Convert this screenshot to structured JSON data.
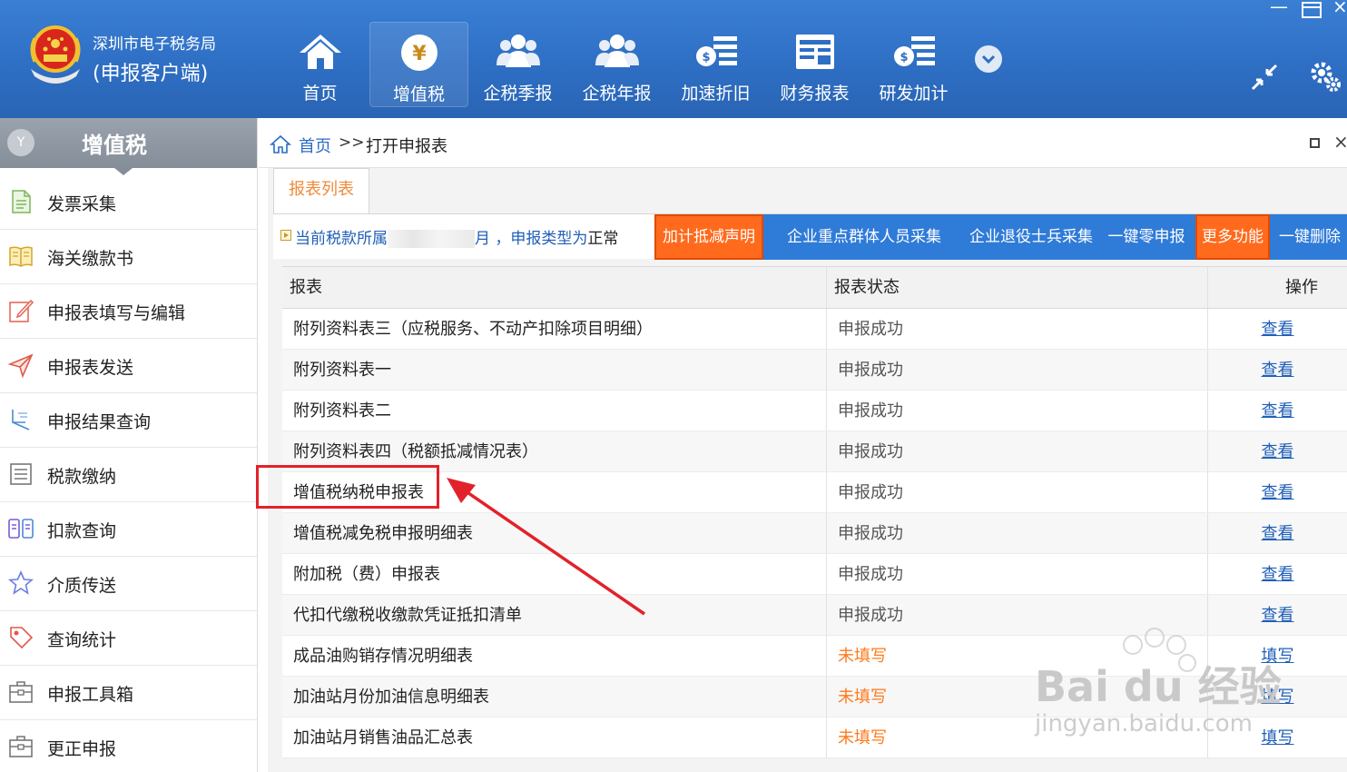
{
  "app": {
    "brand_line1": "深圳市电子税务局",
    "brand_line2": "(申报客户端)"
  },
  "nav": {
    "items": [
      {
        "label": "首页",
        "icon": "home-icon"
      },
      {
        "label": "增值税",
        "icon": "yen-coin-icon",
        "active": true
      },
      {
        "label": "企税季报",
        "icon": "users-icon"
      },
      {
        "label": "企税年报",
        "icon": "users-icon"
      },
      {
        "label": "加速折旧",
        "icon": "money-list-icon"
      },
      {
        "label": "财务报表",
        "icon": "report-icon"
      },
      {
        "label": "研发加计",
        "icon": "money-list-icon"
      }
    ]
  },
  "sidebar": {
    "title": "增值税",
    "badge": "Y",
    "items": [
      {
        "label": "发票采集",
        "icon": "document-icon"
      },
      {
        "label": "海关缴款书",
        "icon": "book-icon"
      },
      {
        "label": "申报表填写与编辑",
        "icon": "edit-icon"
      },
      {
        "label": "申报表发送",
        "icon": "send-icon"
      },
      {
        "label": "申报结果查询",
        "icon": "query-icon"
      },
      {
        "label": "税款缴纳",
        "icon": "list-icon"
      },
      {
        "label": "扣款查询",
        "icon": "receipt-icon"
      },
      {
        "label": "介质传送",
        "icon": "star-icon"
      },
      {
        "label": "查询统计",
        "icon": "tag-icon"
      },
      {
        "label": "申报工具箱",
        "icon": "toolbox-icon"
      },
      {
        "label": "更正申报",
        "icon": "toolbox-icon"
      }
    ]
  },
  "breadcrumb": {
    "home": "首页",
    "sep": ">>",
    "current": "打开申报表"
  },
  "tab": {
    "label": "报表列表"
  },
  "toolbar": {
    "notice_prefix": "当前税款所属",
    "notice_mid": "月 ，申报类型为",
    "notice_type": "正常",
    "buttons": [
      "加计抵减声明",
      "企业重点群体人员采集",
      "企业退役士兵采集",
      "一键零申报",
      "更多功能",
      "一键删除"
    ]
  },
  "table": {
    "headers": [
      "报表",
      "报表状态",
      "操作"
    ],
    "rows": [
      {
        "name": "附列资料表三（应税服务、不动产扣除项目明细）",
        "status": "申报成功",
        "action": "查看"
      },
      {
        "name": "附列资料表一",
        "status": "申报成功",
        "action": "查看"
      },
      {
        "name": "附列资料表二",
        "status": "申报成功",
        "action": "查看"
      },
      {
        "name": "附列资料表四（税额抵减情况表）",
        "status": "申报成功",
        "action": "查看"
      },
      {
        "name": "增值税纳税申报表",
        "status": "申报成功",
        "action": "查看"
      },
      {
        "name": "增值税减免税申报明细表",
        "status": "申报成功",
        "action": "查看"
      },
      {
        "name": "附加税（费）申报表",
        "status": "申报成功",
        "action": "查看"
      },
      {
        "name": "代扣代缴税收缴款凭证抵扣清单",
        "status": "申报成功",
        "action": "查看"
      },
      {
        "name": "成品油购销存情况明细表",
        "status": "未填写",
        "action": "填写"
      },
      {
        "name": "加油站月份加油信息明细表",
        "status": "未填写",
        "action": "填写"
      },
      {
        "name": "加油站月销售油品汇总表",
        "status": "未填写",
        "action": "填写"
      }
    ]
  },
  "colors": {
    "header_blue": "#2e6fc4",
    "button_bar_blue": "#2f7bd8",
    "accent_orange": "#ff6a1c",
    "link_blue": "#1f5fb8",
    "annotation_red": "#e2222a"
  },
  "watermark": {
    "text": "Bai du 经验",
    "sub": "jingyan.baidu.com"
  }
}
